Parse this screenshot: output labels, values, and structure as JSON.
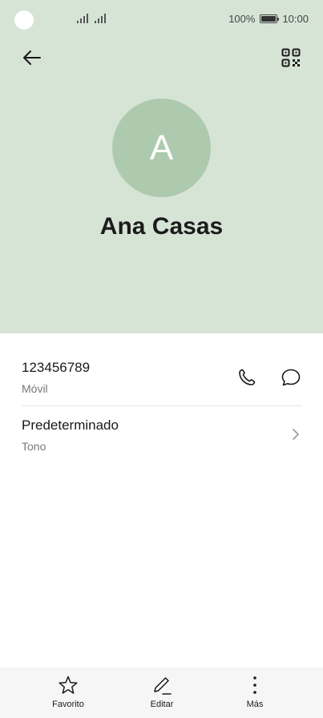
{
  "status_bar": {
    "battery_percent": "100%",
    "time": "10:00"
  },
  "contact": {
    "initial": "A",
    "name": "Ana Casas",
    "avatar_color": "#aecaae",
    "header_color": "#d6e4d6"
  },
  "details": {
    "phone_number": "123456789",
    "phone_type": "Móvil",
    "ringtone_value": "Predeterminado",
    "ringtone_label": "Tono"
  },
  "bottom_bar": {
    "favorite_label": "Favorito",
    "edit_label": "Editar",
    "more_label": "Más"
  },
  "icons": [
    "back-arrow-icon",
    "qr-code-icon",
    "phone-icon",
    "message-icon",
    "chevron-right-icon",
    "star-icon",
    "pencil-icon",
    "more-vertical-icon"
  ]
}
